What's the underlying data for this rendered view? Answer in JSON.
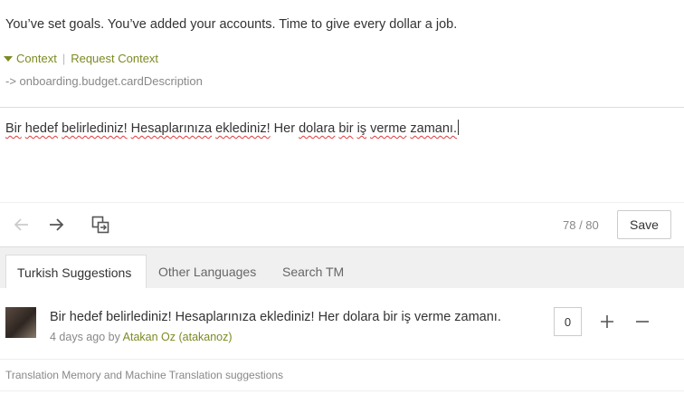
{
  "source": {
    "text": "You’ve set goals. You’ve added your accounts. Time to give every dollar a job.",
    "context_label": "Context",
    "request_context_label": "Request Context",
    "separator": "|",
    "key": "-> onboarding.budget.cardDescription"
  },
  "editor": {
    "words": [
      "Bir",
      "hedef",
      "belirlediniz!",
      "Hesaplarınıza",
      "eklediniz!",
      "Her",
      "dolara",
      "bir",
      "iş",
      "verme",
      "zamanı."
    ]
  },
  "toolbar": {
    "back_icon": "arrow-left-icon",
    "forward_icon": "arrow-right-icon",
    "copy_icon": "copy-source-icon",
    "char_count": "78 / 80",
    "save_label": "Save"
  },
  "tabs": [
    {
      "label": "Turkish Suggestions",
      "active": true
    },
    {
      "label": "Other Languages",
      "active": false
    },
    {
      "label": "Search TM",
      "active": false
    }
  ],
  "suggestion": {
    "text": "Bir hedef belirlediniz! Hesaplarınıza eklediniz! Her dolara bir iş verme zamanı.",
    "time": "4 days ago by",
    "user": "Atakan Oz (atakanoz)",
    "votes": "0"
  },
  "footer": {
    "text": "Translation Memory and Machine Translation suggestions"
  },
  "colors": {
    "accent": "#7d8a23",
    "spellcheck": "#e03b3b"
  }
}
